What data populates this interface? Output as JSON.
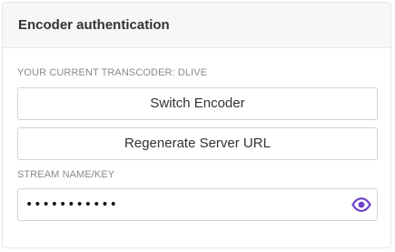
{
  "panel": {
    "title": "Encoder authentication"
  },
  "transcoder": {
    "label": "YOUR CURRENT TRANSCODER: DLIVE"
  },
  "buttons": {
    "switch_encoder": "Switch Encoder",
    "regenerate_url": "Regenerate Server URL"
  },
  "stream_key": {
    "label": "STREAM NAME/KEY",
    "value": "•••••••••••",
    "icon": "eye-icon"
  },
  "colors": {
    "accent": "#6b41c8",
    "header_bg": "#f7f7f7",
    "border": "#d4d4d4",
    "label_text": "#8a8a8a"
  }
}
